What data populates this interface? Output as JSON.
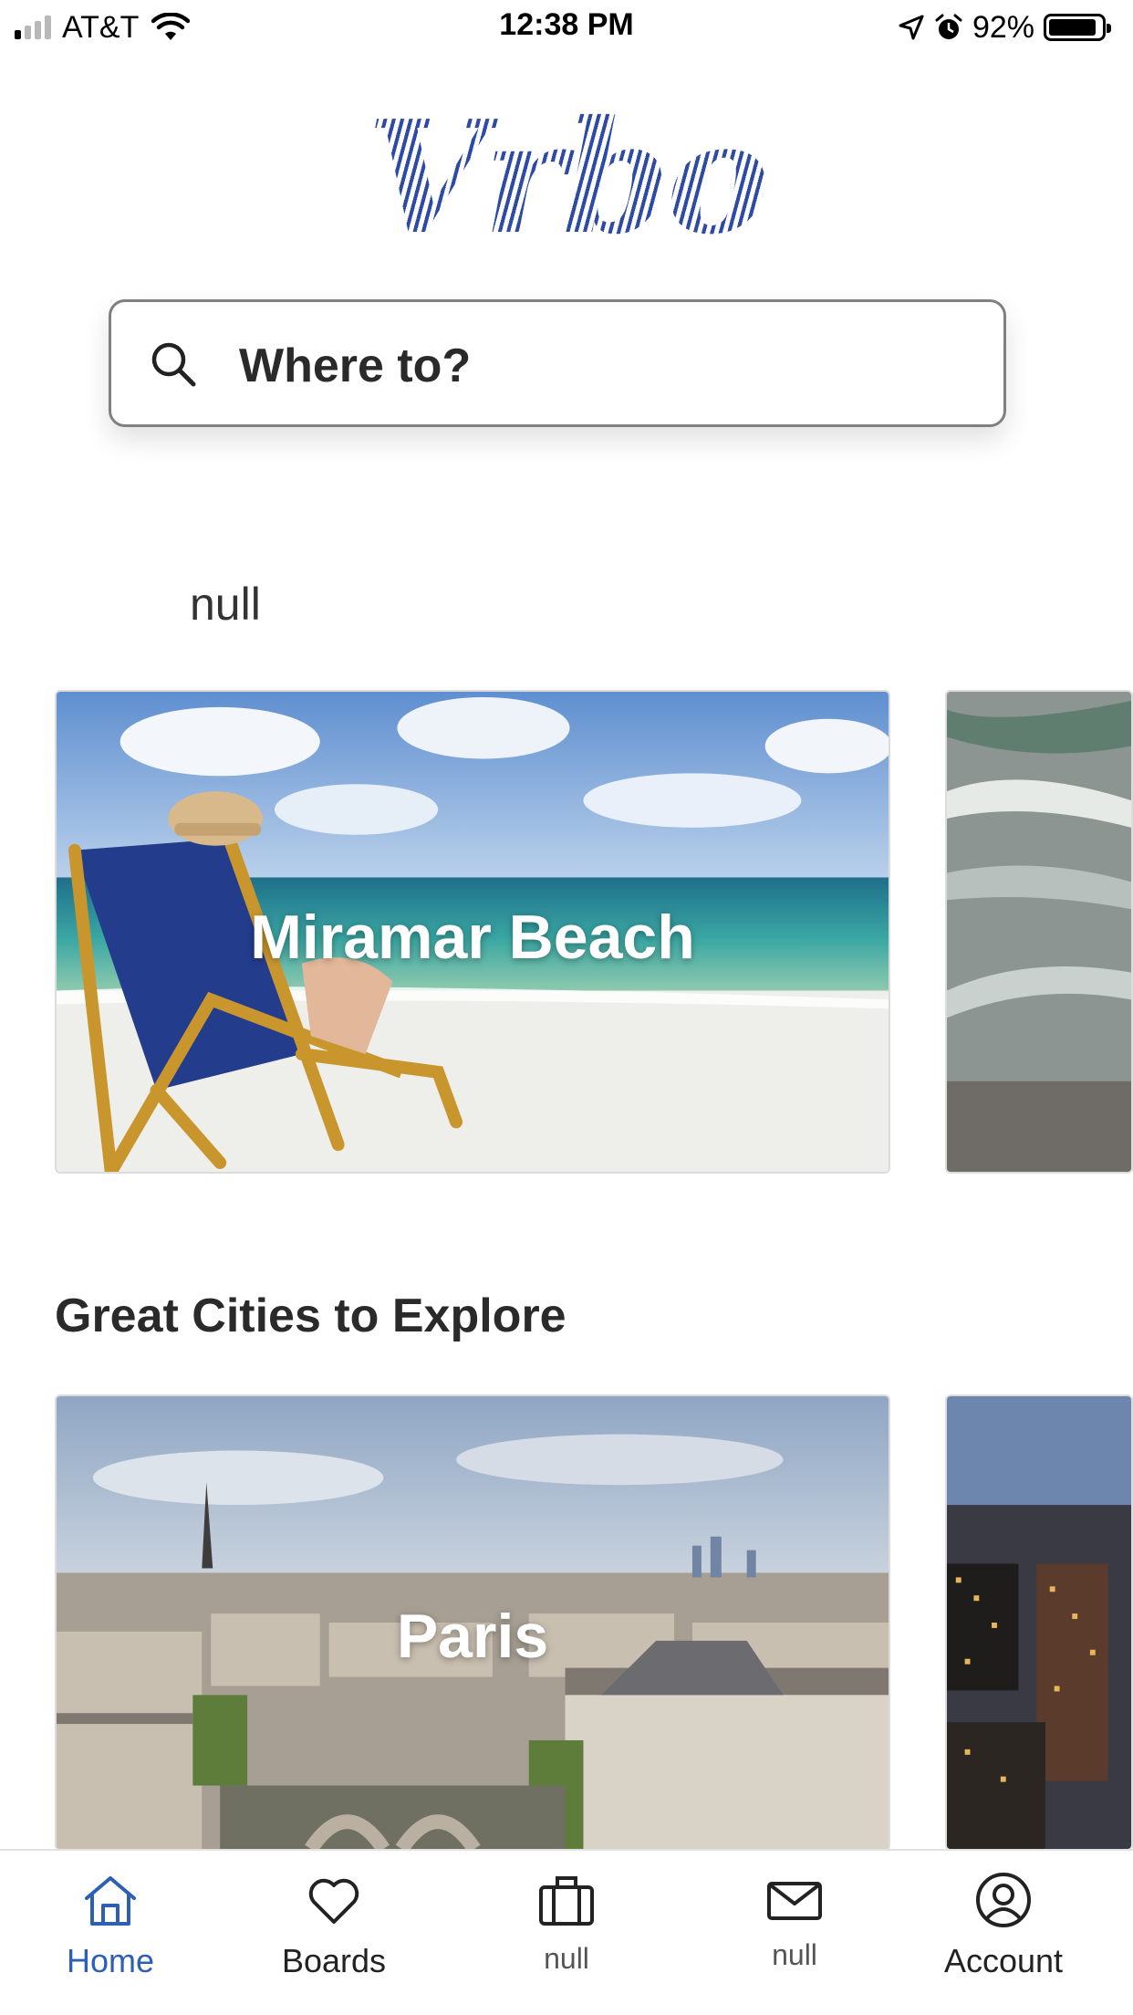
{
  "status_bar": {
    "carrier": "AT&T",
    "time": "12:38 PM",
    "battery_percent": "92%",
    "battery_level": 0.92,
    "signal_bars_active": 1,
    "signal_bars_total": 4,
    "icons": [
      "signal-icon",
      "wifi-icon",
      "location-arrow-icon",
      "alarm-icon",
      "battery-icon"
    ]
  },
  "brand": {
    "logo_text": "Vrbo",
    "color": "#2d4aa6"
  },
  "search": {
    "placeholder": "Where to?"
  },
  "sections": [
    {
      "title": "null",
      "cards": [
        {
          "label": "Miramar Beach",
          "image": "beach-chair-ocean"
        },
        {
          "label": "",
          "image": "ocean-waves"
        }
      ]
    },
    {
      "title": "Great Cities to Explore",
      "cards": [
        {
          "label": "Paris",
          "image": "paris-skyline"
        },
        {
          "label": "",
          "image": "city-skyscrapers-dusk"
        }
      ]
    }
  ],
  "tab_bar": {
    "active_color": "#2d5fb3",
    "tabs": [
      {
        "label": "Home",
        "icon": "home-icon",
        "active": true
      },
      {
        "label": "Boards",
        "icon": "heart-icon",
        "active": false
      },
      {
        "label": "null",
        "icon": "suitcase-icon",
        "active": false
      },
      {
        "label": "null",
        "icon": "mail-icon",
        "active": false
      },
      {
        "label": "Account",
        "icon": "account-icon",
        "active": false
      }
    ]
  }
}
